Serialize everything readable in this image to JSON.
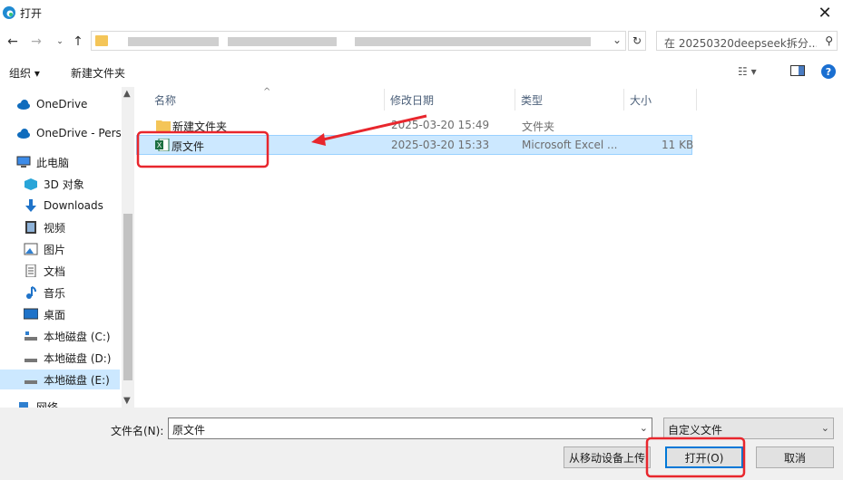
{
  "window": {
    "title": "打开"
  },
  "address": {
    "search_placeholder": "在 20250320deepseek拆分..."
  },
  "toolbar": {
    "organize_label": "组织 ▾",
    "new_folder_label": "新建文件夹"
  },
  "nav": {
    "items": [
      {
        "label": "OneDrive",
        "icon": "cloud-icon"
      },
      {
        "label": "OneDrive - Perso",
        "icon": "cloud-icon"
      },
      {
        "label": "此电脑",
        "icon": "computer-icon"
      },
      {
        "label": "3D 对象",
        "icon": "3d-objects-icon"
      },
      {
        "label": "Downloads",
        "icon": "download-icon"
      },
      {
        "label": "视频",
        "icon": "video-icon"
      },
      {
        "label": "图片",
        "icon": "picture-icon"
      },
      {
        "label": "文档",
        "icon": "document-icon"
      },
      {
        "label": "音乐",
        "icon": "music-icon"
      },
      {
        "label": "桌面",
        "icon": "desktop-icon"
      },
      {
        "label": "本地磁盘 (C:)",
        "icon": "drive-icon"
      },
      {
        "label": "本地磁盘 (D:)",
        "icon": "drive-icon"
      },
      {
        "label": "本地磁盘 (E:)",
        "icon": "drive-icon"
      },
      {
        "label": "网络",
        "icon": "network-icon"
      }
    ]
  },
  "columns": {
    "name": "名称",
    "modified": "修改日期",
    "type": "类型",
    "size": "大小"
  },
  "files": [
    {
      "name": "新建文件夹",
      "modified": "2025-03-20 15:49",
      "type": "文件夹",
      "size": "",
      "icon": "folder-icon"
    },
    {
      "name": "原文件",
      "modified": "2025-03-20 15:33",
      "type": "Microsoft Excel ...",
      "size": "11 KB",
      "icon": "excel-file-icon"
    }
  ],
  "bottom": {
    "filename_label": "文件名(N):",
    "filename_value": "原文件",
    "filetype_value": "自定义文件",
    "upload_label": "从移动设备上传",
    "open_label": "打开(O)",
    "cancel_label": "取消"
  },
  "colors": {
    "selection": "#cce8ff",
    "annotation": "#e8262d",
    "accent": "#0078d7"
  }
}
